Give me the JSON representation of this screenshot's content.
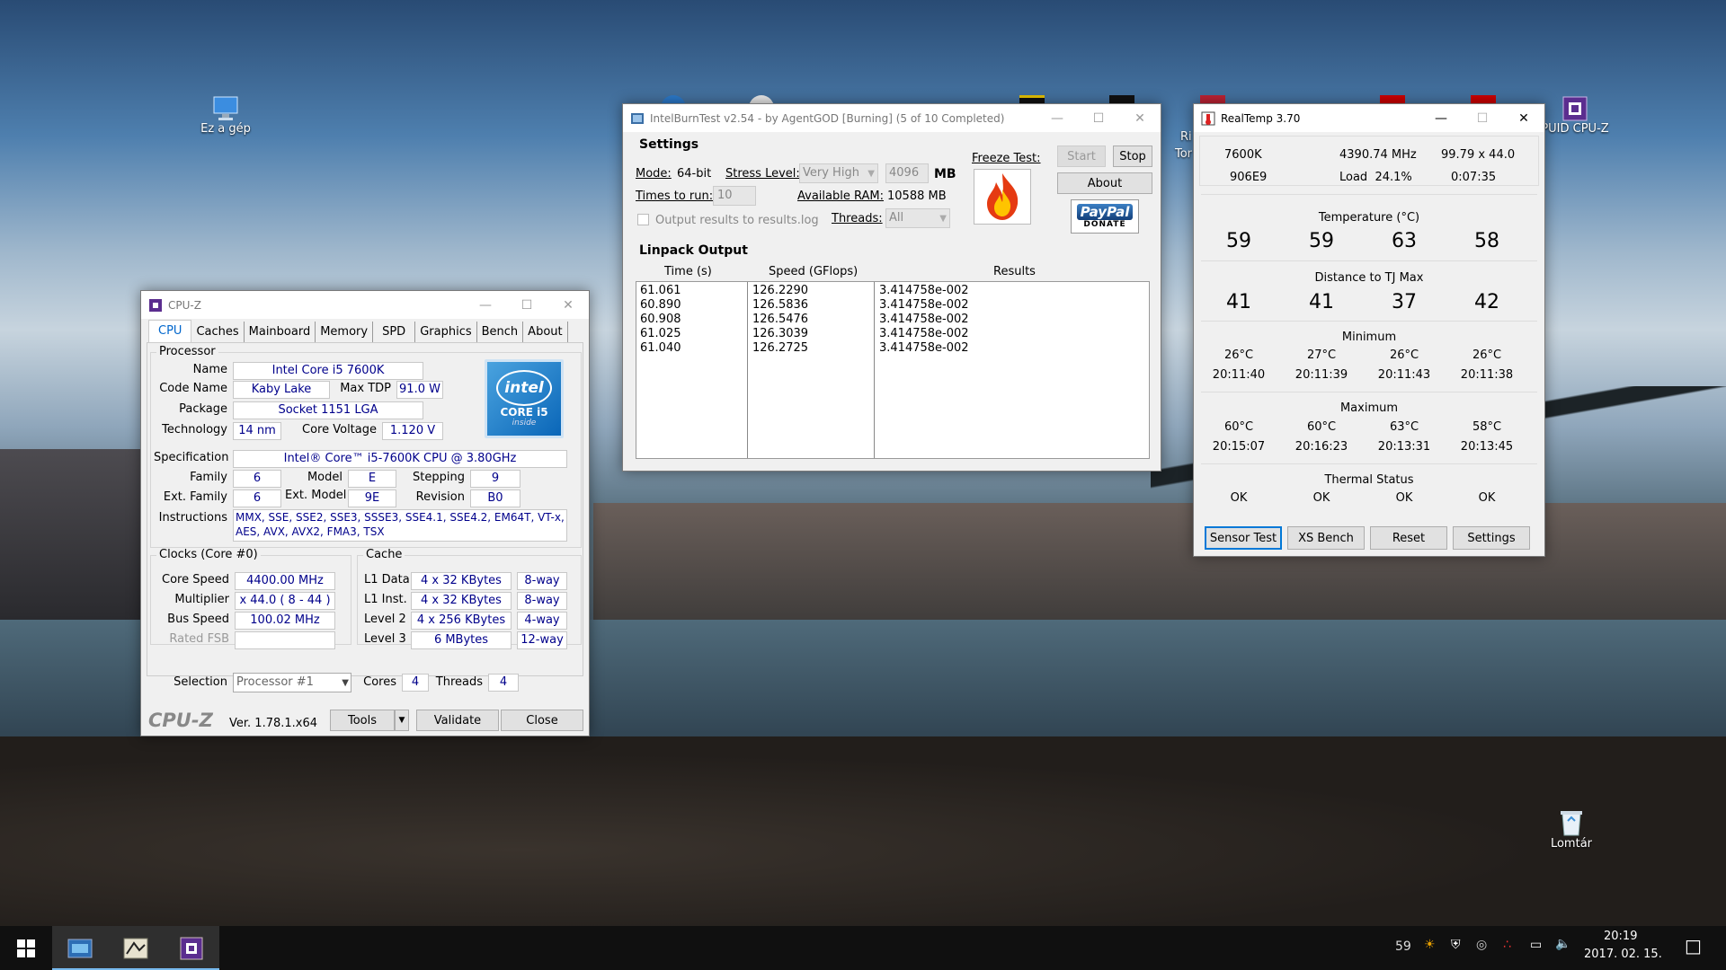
{
  "desktop": {
    "icons": [
      {
        "label": "Ez a gép",
        "kind": "computer"
      },
      {
        "label": "Lomtár",
        "kind": "recycle-bin"
      },
      {
        "label": "PUID CPU-Z",
        "kind": "cpuid"
      },
      {
        "label": "Ri",
        "kind": "partial"
      },
      {
        "label": "Tor",
        "kind": "partial"
      }
    ]
  },
  "cpuz": {
    "title": "CPU-Z",
    "tabs": [
      "CPU",
      "Caches",
      "Mainboard",
      "Memory",
      "SPD",
      "Graphics",
      "Bench",
      "About"
    ],
    "processor_group": "Processor",
    "labels": {
      "name": "Name",
      "code_name": "Code Name",
      "max_tdp": "Max TDP",
      "package": "Package",
      "technology": "Technology",
      "core_voltage": "Core Voltage",
      "specification": "Specification",
      "family": "Family",
      "model": "Model",
      "stepping": "Stepping",
      "ext_family": "Ext. Family",
      "ext_model": "Ext. Model",
      "revision": "Revision",
      "instructions": "Instructions"
    },
    "values": {
      "name": "Intel Core i5 7600K",
      "code_name": "Kaby Lake",
      "max_tdp": "91.0 W",
      "package": "Socket 1151 LGA",
      "technology": "14 nm",
      "core_voltage": "1.120 V",
      "specification": "Intel® Core™ i5-7600K CPU @ 3.80GHz",
      "family": "6",
      "model": "E",
      "stepping": "9",
      "ext_family": "6",
      "ext_model": "9E",
      "revision": "B0",
      "instructions": "MMX, SSE, SSE2, SSE3, SSSE3, SSE4.1, SSE4.2, EM64T, VT-x, AES, AVX, AVX2, FMA3, TSX"
    },
    "logo": {
      "brand": "intel",
      "line": "CORE i5",
      "sub": "inside"
    },
    "clocks_group": "Clocks (Core #0)",
    "clocks": {
      "labels": [
        "Core Speed",
        "Multiplier",
        "Bus Speed",
        "Rated FSB"
      ],
      "values": [
        "4400.00 MHz",
        "x 44.0 ( 8 - 44 )",
        "100.02 MHz",
        ""
      ]
    },
    "cache_group": "Cache",
    "cache": [
      {
        "label": "L1 Data",
        "size": "4 x 32 KBytes",
        "way": "8-way"
      },
      {
        "label": "L1 Inst.",
        "size": "4 x 32 KBytes",
        "way": "8-way"
      },
      {
        "label": "Level 2",
        "size": "4 x 256 KBytes",
        "way": "4-way"
      },
      {
        "label": "Level 3",
        "size": "6 MBytes",
        "way": "12-way"
      }
    ],
    "selection_label": "Selection",
    "selection_value": "Processor #1",
    "cores_label": "Cores",
    "cores": "4",
    "threads_label": "Threads",
    "threads": "4",
    "brand": "CPU-Z",
    "version": "Ver. 1.78.1.x64",
    "buttons": {
      "tools": "Tools",
      "validate": "Validate",
      "close": "Close"
    }
  },
  "ibt": {
    "title": "IntelBurnTest v2.54 - by AgentGOD [Burning] (5 of 10 Completed)",
    "settings_label": "Settings",
    "mode_label": "Mode:",
    "mode_value": "64-bit",
    "stress_label": "Stress Level:",
    "stress_value": "Very High",
    "mem_value": "4096",
    "mem_unit": "MB",
    "times_label": "Times to run:",
    "times_value": "10",
    "ram_label": "Available RAM:",
    "ram_value": "10588 MB",
    "output_checkbox": "Output results to results.log",
    "threads_label": "Threads:",
    "threads_value": "All",
    "freeze_label": "Freeze Test:",
    "buttons": {
      "start": "Start",
      "stop": "Stop",
      "about": "About"
    },
    "paypal": {
      "main": "PayPal",
      "sub": "DONATE"
    },
    "linpack_label": "Linpack Output",
    "columns": [
      "Time (s)",
      "Speed (GFlops)",
      "Results"
    ],
    "rows": [
      {
        "time": "61.061",
        "speed": "126.2290",
        "result": "3.414758e-002"
      },
      {
        "time": "60.890",
        "speed": "126.5836",
        "result": "3.414758e-002"
      },
      {
        "time": "60.908",
        "speed": "126.5476",
        "result": "3.414758e-002"
      },
      {
        "time": "61.025",
        "speed": "126.3039",
        "result": "3.414758e-002"
      },
      {
        "time": "61.040",
        "speed": "126.2725",
        "result": "3.414758e-002"
      }
    ]
  },
  "realtemp": {
    "title": "RealTemp 3.70",
    "info": [
      "7600K",
      "4390.74 MHz",
      "99.79 x 44.0",
      "906E9",
      "Load  24.1%",
      "0:07:35"
    ],
    "temp_label": "Temperature (°C)",
    "temps": [
      "59",
      "59",
      "63",
      "58"
    ],
    "tj_label": "Distance to TJ Max",
    "tj": [
      "41",
      "41",
      "37",
      "42"
    ],
    "min_label": "Minimum",
    "min_temps": [
      "26°C",
      "27°C",
      "26°C",
      "26°C"
    ],
    "min_times": [
      "20:11:40",
      "20:11:39",
      "20:11:43",
      "20:11:38"
    ],
    "max_label": "Maximum",
    "max_temps": [
      "60°C",
      "60°C",
      "63°C",
      "58°C"
    ],
    "max_times": [
      "20:15:07",
      "20:16:23",
      "20:13:31",
      "20:13:45"
    ],
    "status_label": "Thermal Status",
    "status": [
      "OK",
      "OK",
      "OK",
      "OK"
    ],
    "buttons": {
      "sensor": "Sensor Test",
      "xs": "XS Bench",
      "reset": "Reset",
      "settings": "Settings"
    }
  },
  "taskbar": {
    "tray_temp": "59",
    "time": "20:19",
    "date": "2017. 02. 15."
  },
  "colors": {
    "accent": "#0078d7",
    "value_text": "#00008b",
    "taskbar": "#101010"
  }
}
